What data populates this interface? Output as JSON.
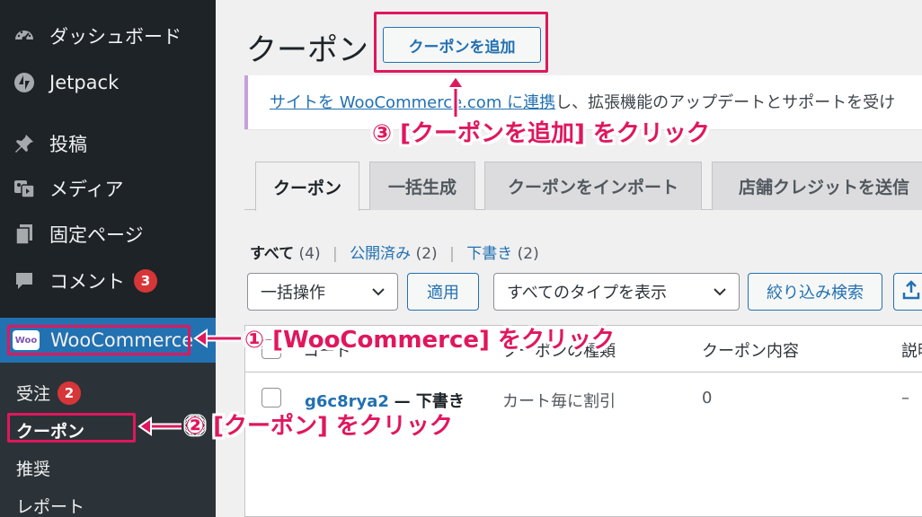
{
  "sidebar": {
    "items": [
      {
        "label": "ダッシュボード",
        "icon": "dashboard-icon"
      },
      {
        "label": "Jetpack",
        "icon": "jetpack-icon"
      },
      {
        "label": "投稿",
        "icon": "pin-icon"
      },
      {
        "label": "メディア",
        "icon": "media-icon"
      },
      {
        "label": "固定ページ",
        "icon": "page-icon"
      },
      {
        "label": "コメント",
        "icon": "comment-icon",
        "badge": "3"
      }
    ],
    "woocommerce": {
      "label": "WooCommerce",
      "logo_text": "Woo"
    },
    "submenu": [
      {
        "label": "受注",
        "badge": "2"
      },
      {
        "label": "クーポン"
      },
      {
        "label": "推奨"
      },
      {
        "label": "レポート"
      }
    ]
  },
  "main": {
    "title": "クーポン",
    "add_button": "クーポンを追加",
    "notice": {
      "link": "サイトを WooCommerce.com に連携",
      "text": "し、拡張機能のアップデートとサポートを受け"
    },
    "tabs": [
      "クーポン",
      "一括生成",
      "クーポンをインポート",
      "店舗クレジットを送信"
    ],
    "filters": {
      "all": "すべて",
      "all_count": "(4)",
      "published": "公開済み",
      "published_count": "(2)",
      "draft": "下書き",
      "draft_count": "(2)"
    },
    "bulk_select": "一括操作",
    "apply": "適用",
    "type_select": "すべてのタイプを表示",
    "filter_button": "絞り込み検索",
    "table": {
      "headers": [
        "コード",
        "クーポンの種類",
        "クーポン内容",
        "説明"
      ],
      "rows": [
        {
          "code": "g6c8rya2",
          "state": "— 下書き",
          "type": "カート毎に割引",
          "amount": "0",
          "desc": "–"
        }
      ]
    }
  },
  "annotations": {
    "step1": "① [WooCommerce] をクリック",
    "step2": "② [クーポン] をクリック",
    "step3": "③ [クーポンを追加] をクリック",
    "color": "#e0175d"
  },
  "colors": {
    "sidebar": "#1d2327",
    "submenu": "#2c3338",
    "accent": "#2271b1",
    "badge": "#d63638"
  }
}
